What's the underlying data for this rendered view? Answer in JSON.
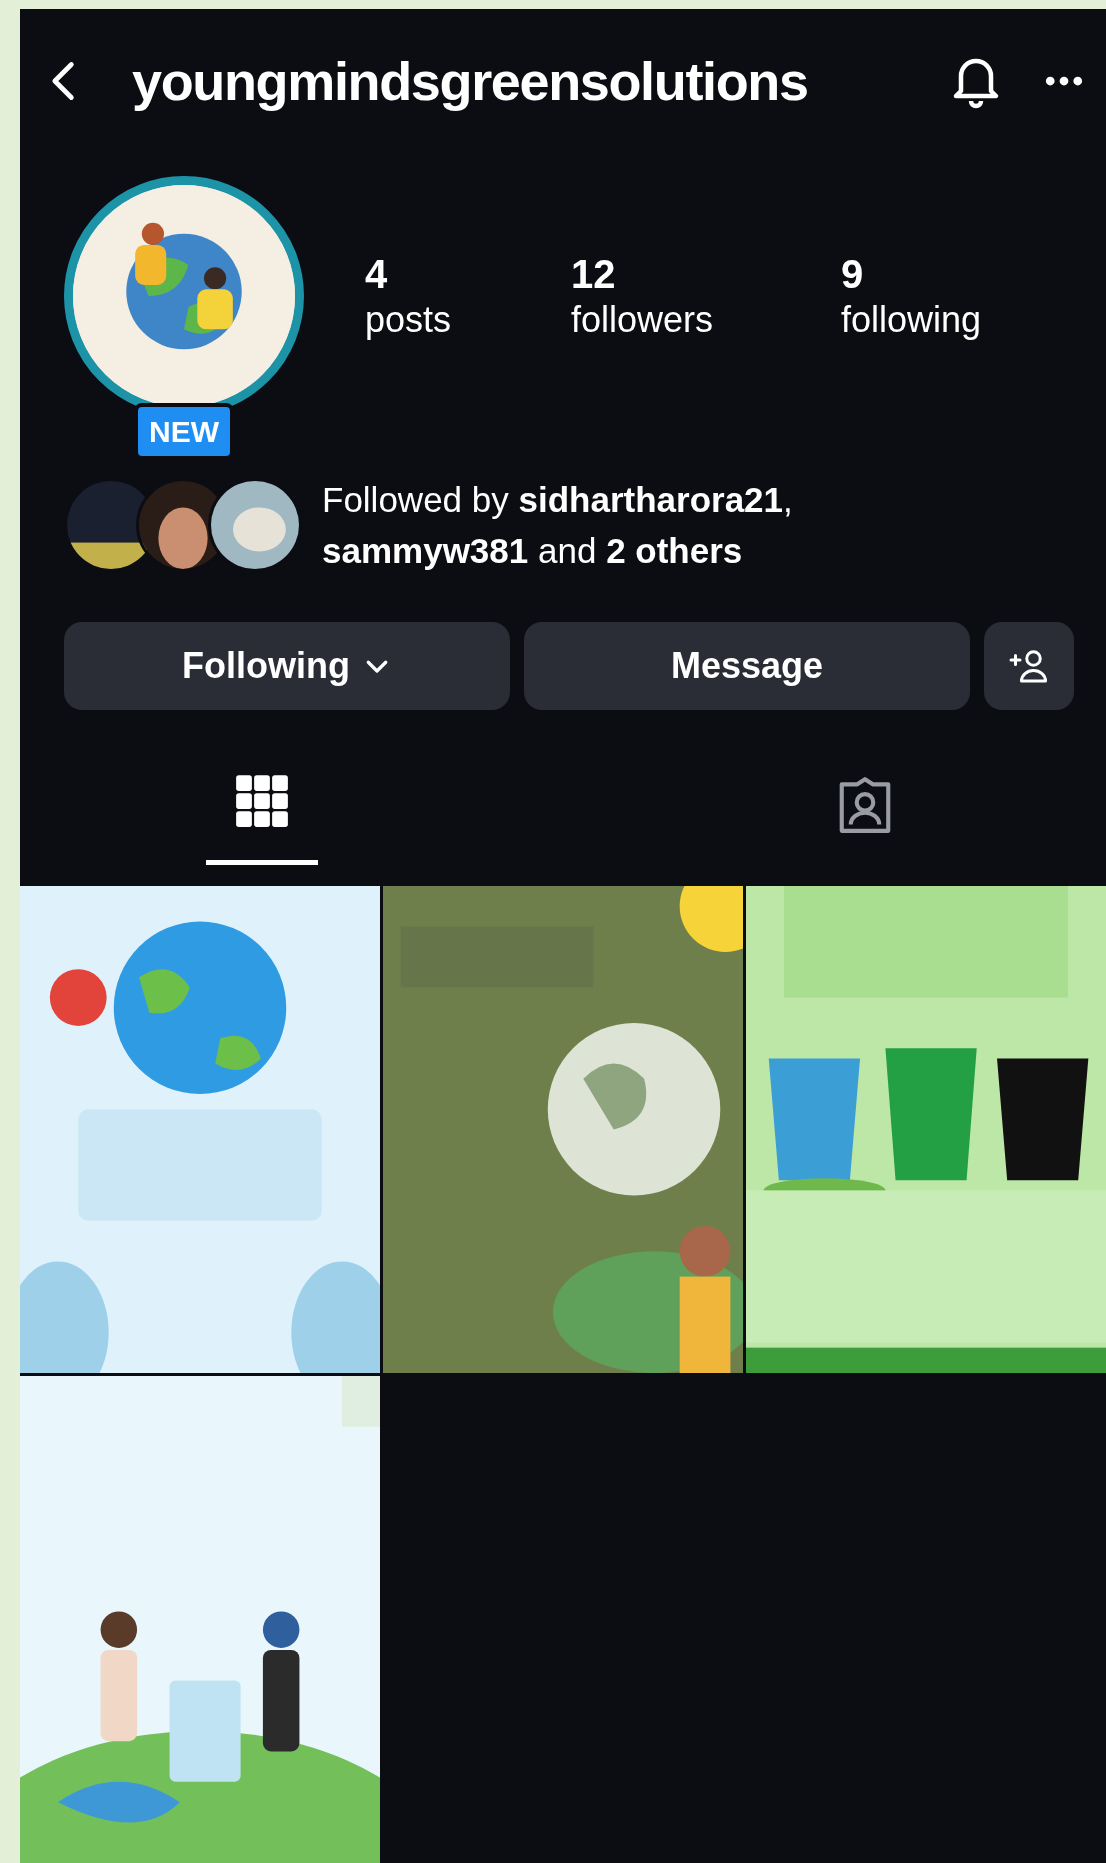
{
  "header": {
    "username": "youngmindsgreensolutions"
  },
  "profile": {
    "badge": "NEW",
    "stats": [
      {
        "value": "4",
        "label": "posts"
      },
      {
        "value": "12",
        "label": "followers"
      },
      {
        "value": "9",
        "label": "following"
      }
    ]
  },
  "followed_by": {
    "text": "Followed by **sidhartharora21**, **sammyw381** and **2 others**"
  },
  "actions": [
    {
      "kind": "dropdown",
      "label": "Following"
    },
    {
      "kind": "button",
      "label": "Message"
    },
    {
      "kind": "add-person"
    }
  ],
  "tabs": [
    {
      "kind": "grid",
      "selected": true
    },
    {
      "kind": "tagged",
      "selected": false
    }
  ]
}
